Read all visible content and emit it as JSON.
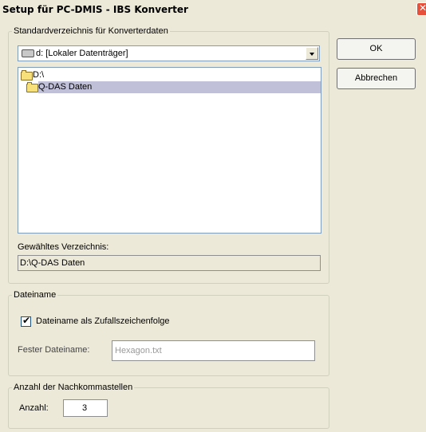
{
  "window": {
    "title": "Setup für PC-DMIS - IBS Konverter",
    "close_glyph": "✕",
    "close_color": "#e7503b"
  },
  "buttons": {
    "ok_label": "OK",
    "cancel_label": "Abbrechen"
  },
  "directory_group": {
    "legend": "Standardverzeichnis für Konverterdaten",
    "drive_select": {
      "value": "d: [Lokaler Datenträger]",
      "icon": "drive-icon"
    },
    "folders": [
      {
        "label": "D:\\",
        "icon": "open-folder-icon",
        "selected": false
      },
      {
        "label": "Q-DAS Daten",
        "icon": "open-folder-icon",
        "selected": true
      }
    ],
    "selected_label": "Gewähltes Verzeichnis:",
    "selected_value": "D:\\Q-DAS Daten"
  },
  "filename_group": {
    "legend": "Dateiname",
    "random_checkbox_label": "Dateiname als Zufallszeichenfolge",
    "random_checked": true,
    "fixed_label": "Fester Dateiname:",
    "fixed_value": "Hexagon.txt"
  },
  "decimals_group": {
    "legend": "Anzahl der Nachkommastellen",
    "count_label": "Anzahl:",
    "count_value": "3"
  }
}
